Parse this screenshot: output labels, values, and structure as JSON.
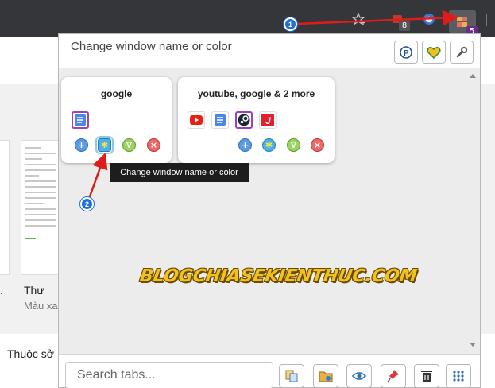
{
  "toolbar": {
    "star_icon": "star-plus-icon",
    "ext_badge_1": "8",
    "ext_badge_2": "5"
  },
  "background_page": {
    "text_1": ".",
    "text_2": "Thư",
    "text_3": "Màu xa",
    "text_4": "Thuộc sở"
  },
  "popup": {
    "title": "Change window name or color",
    "groups": [
      {
        "title": "google",
        "tabs": [
          "google-docs-icon"
        ]
      },
      {
        "title": "youtube, google & 2 more",
        "tabs": [
          "youtube-icon",
          "google-docs-icon",
          "steam-icon",
          "jira-icon"
        ]
      }
    ],
    "tooltip": "Change window name or color",
    "search_placeholder": "Search tabs..."
  },
  "watermark": "BLOGCHIASEKIENTHUC.COM",
  "annotations": {
    "marker_1": "1",
    "marker_2": "2"
  },
  "colors": {
    "accent_purple": "#9b3fc4",
    "annotation_red": "#e01b1b",
    "annotation_blue": "#1f6fd6",
    "watermark_yellow": "#f1c21c"
  }
}
